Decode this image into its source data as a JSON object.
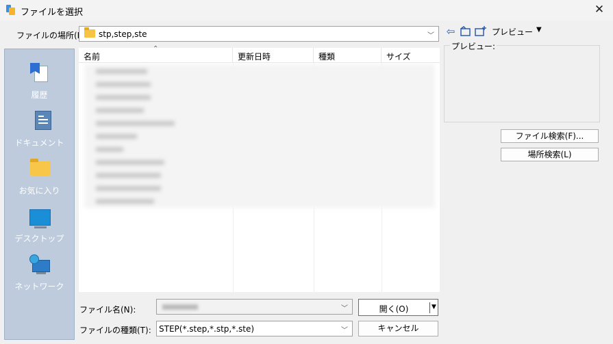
{
  "window": {
    "title": "ファイルを選択",
    "close_glyph": "✕"
  },
  "location": {
    "label": "ファイルの場所(I):",
    "value": "stp,step,ste"
  },
  "toolbar": {
    "preview_label": "プレビュー",
    "back_glyph": "⇦",
    "up_glyph": "⮤",
    "newfolder_glyph": "+",
    "dropdown_glyph": "▼"
  },
  "places": [
    {
      "label": "履歴",
      "icon": "history-icon"
    },
    {
      "label": "ドキュメント",
      "icon": "documents-icon"
    },
    {
      "label": "お気に入り",
      "icon": "favorites-folder-icon"
    },
    {
      "label": "デスクトップ",
      "icon": "desktop-icon"
    },
    {
      "label": "ネットワーク",
      "icon": "network-icon"
    }
  ],
  "columns": {
    "name": "名前",
    "modified": "更新日時",
    "type": "種類",
    "size": "サイズ"
  },
  "preview": {
    "box_label": "プレビュー:"
  },
  "side_buttons": {
    "file_search": "ファイル検索(F)...",
    "location_search": "場所検索(L)"
  },
  "bottom": {
    "filename_label": "ファイル名(N):",
    "filetype_label": "ファイルの種類(T):",
    "filetype_value": "STEP(*.step,*.stp,*.ste)",
    "open_label": "開く(O)",
    "cancel_label": "キャンセル"
  }
}
